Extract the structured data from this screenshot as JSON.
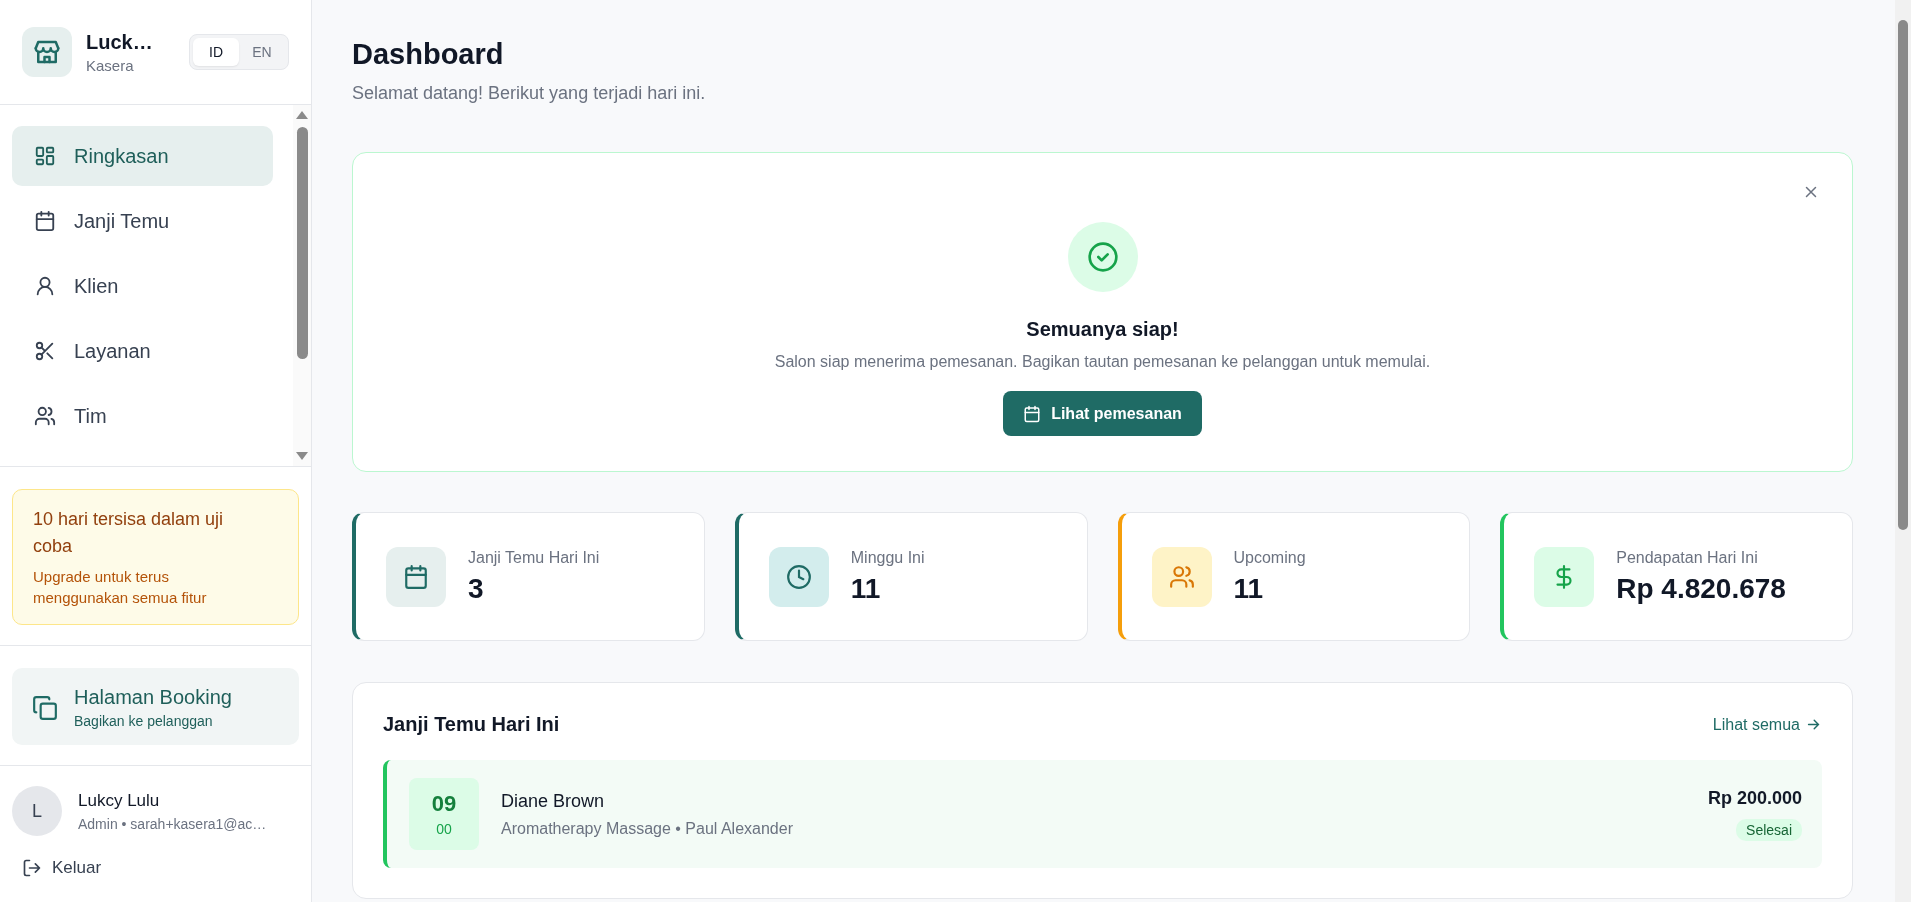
{
  "sidebar": {
    "brand": {
      "name": "Luck…",
      "subtitle": "Kasera"
    },
    "languages": [
      {
        "label": "ID",
        "selected": true
      },
      {
        "label": "EN",
        "selected": false
      }
    ],
    "nav": [
      {
        "label": "Ringkasan",
        "kind": "grid",
        "selected": true
      },
      {
        "label": "Janji Temu",
        "kind": "calendar",
        "selected": false
      },
      {
        "label": "Klien",
        "kind": "user",
        "selected": false
      },
      {
        "label": "Layanan",
        "kind": "scissors",
        "selected": false
      },
      {
        "label": "Tim",
        "kind": "users",
        "selected": false
      }
    ],
    "trial": {
      "title": "10 hari tersisa dalam uji coba",
      "text": "Upgrade untuk terus menggunakan semua fitur"
    },
    "booking": {
      "title": "Halaman Booking",
      "subtitle": "Bagikan ke pelanggan"
    },
    "user": {
      "initial": "L",
      "name": "Lukcy Lulu",
      "detail": "Admin • sarah+kasera1@ac…"
    },
    "logout": "Keluar"
  },
  "header": {
    "title": "Dashboard",
    "subtitle": "Selamat datang! Berikut yang terjadi hari ini."
  },
  "banner": {
    "title": "Semuanya siap!",
    "text": "Salon siap menerima pemesanan. Bagikan tautan pemesanan ke pelanggan untuk memulai.",
    "button": "Lihat pemesanan"
  },
  "stats": [
    {
      "label": "Janji Temu Hari Ini",
      "value": "3",
      "kind": "calendar",
      "color": "#1f6b65"
    },
    {
      "label": "Minggu Ini",
      "value": "11",
      "kind": "clock",
      "color": "#1f6b65"
    },
    {
      "label": "Upcoming",
      "value": "11",
      "kind": "users",
      "color": "#f59e0b"
    },
    {
      "label": "Pendapatan Hari Ini",
      "value": "Rp 4.820.678",
      "kind": "dollar",
      "color": "#22c55e"
    }
  ],
  "appointments": {
    "title": "Janji Temu Hari Ini",
    "link": "Lihat semua",
    "rows": [
      {
        "hour": "09",
        "minute": "00",
        "client": "Diane Brown",
        "detail": "Aromatherapy Massage • Paul Alexander",
        "price": "Rp 200.000",
        "status": "Selesai",
        "color": "#22c55e"
      }
    ]
  }
}
